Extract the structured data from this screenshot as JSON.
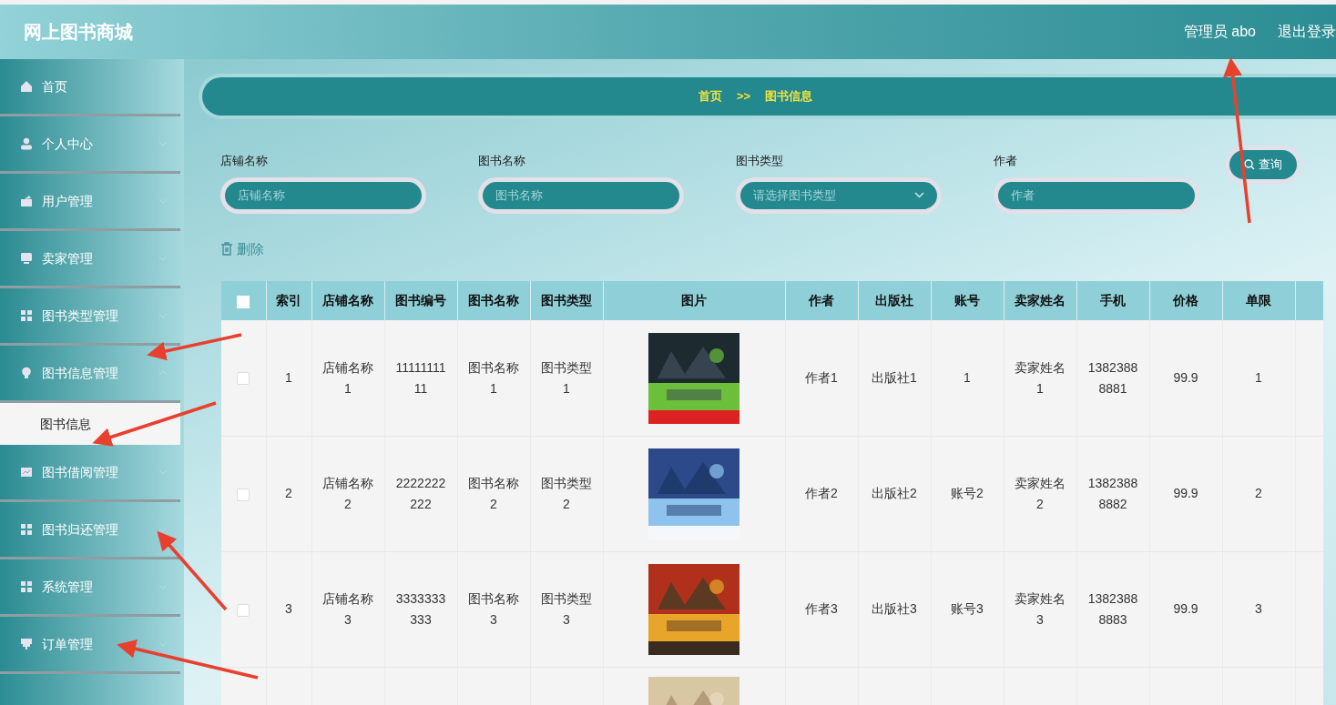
{
  "header": {
    "title": "网上图书商城",
    "user": "管理员 abo",
    "logout": "退出登录"
  },
  "sidebar": {
    "items": [
      {
        "label": "首页"
      },
      {
        "label": "个人中心",
        "expanded": false
      },
      {
        "label": "用户管理",
        "expanded": false
      },
      {
        "label": "卖家管理",
        "expanded": false
      },
      {
        "label": "图书类型管理",
        "expanded": false
      },
      {
        "label": "图书信息管理",
        "expanded": true,
        "children": [
          {
            "label": "图书信息",
            "selected": true
          }
        ]
      },
      {
        "label": "图书借阅管理",
        "expanded": false
      },
      {
        "label": "图书归还管理",
        "expanded": false
      },
      {
        "label": "系统管理",
        "expanded": false
      },
      {
        "label": "订单管理",
        "expanded": false
      }
    ]
  },
  "breadcrumb": {
    "items": [
      "首页",
      "图书信息"
    ],
    "separator": ">>"
  },
  "search": {
    "fields": [
      {
        "label": "店铺名称",
        "placeholder": "店铺名称",
        "kind": "input"
      },
      {
        "label": "图书名称",
        "placeholder": "图书名称",
        "kind": "input"
      },
      {
        "label": "图书类型",
        "placeholder": "请选择图书类型",
        "kind": "select"
      },
      {
        "label": "作者",
        "placeholder": "作者",
        "kind": "input"
      }
    ],
    "button": "查询"
  },
  "toolbar": {
    "delete": "删除"
  },
  "table": {
    "select_all_checked": false,
    "columns": [
      "索引",
      "店铺名称",
      "图书编号",
      "图书名称",
      "图书类型",
      "图片",
      "作者",
      "出版社",
      "账号",
      "卖家姓名",
      "手机",
      "价格",
      "单限"
    ],
    "rows": [
      {
        "checked": false,
        "cells": [
          "1",
          "店铺名称1",
          "1111111111",
          "图书名称1",
          "图书类型1",
          null,
          "作者1",
          "出版社1",
          "1",
          "卖家姓名1",
          "13823888881",
          "99.9",
          "1"
        ]
      },
      {
        "checked": false,
        "cells": [
          "2",
          "店铺名称2",
          "2222222222",
          "图书名称2",
          "图书类型2",
          null,
          "作者2",
          "出版社2",
          "账号2",
          "卖家姓名2",
          "13823888882",
          "99.9",
          "2"
        ]
      },
      {
        "checked": false,
        "cells": [
          "3",
          "店铺名称3",
          "3333333333",
          "图书名称3",
          "图书类型3",
          null,
          "作者3",
          "出版社3",
          "账号3",
          "卖家姓名3",
          "13823888883",
          "99.9",
          "3"
        ]
      },
      {
        "cells": [
          null,
          null,
          null,
          null,
          null,
          null,
          null,
          null,
          null,
          null,
          null,
          null,
          null
        ]
      }
    ]
  }
}
